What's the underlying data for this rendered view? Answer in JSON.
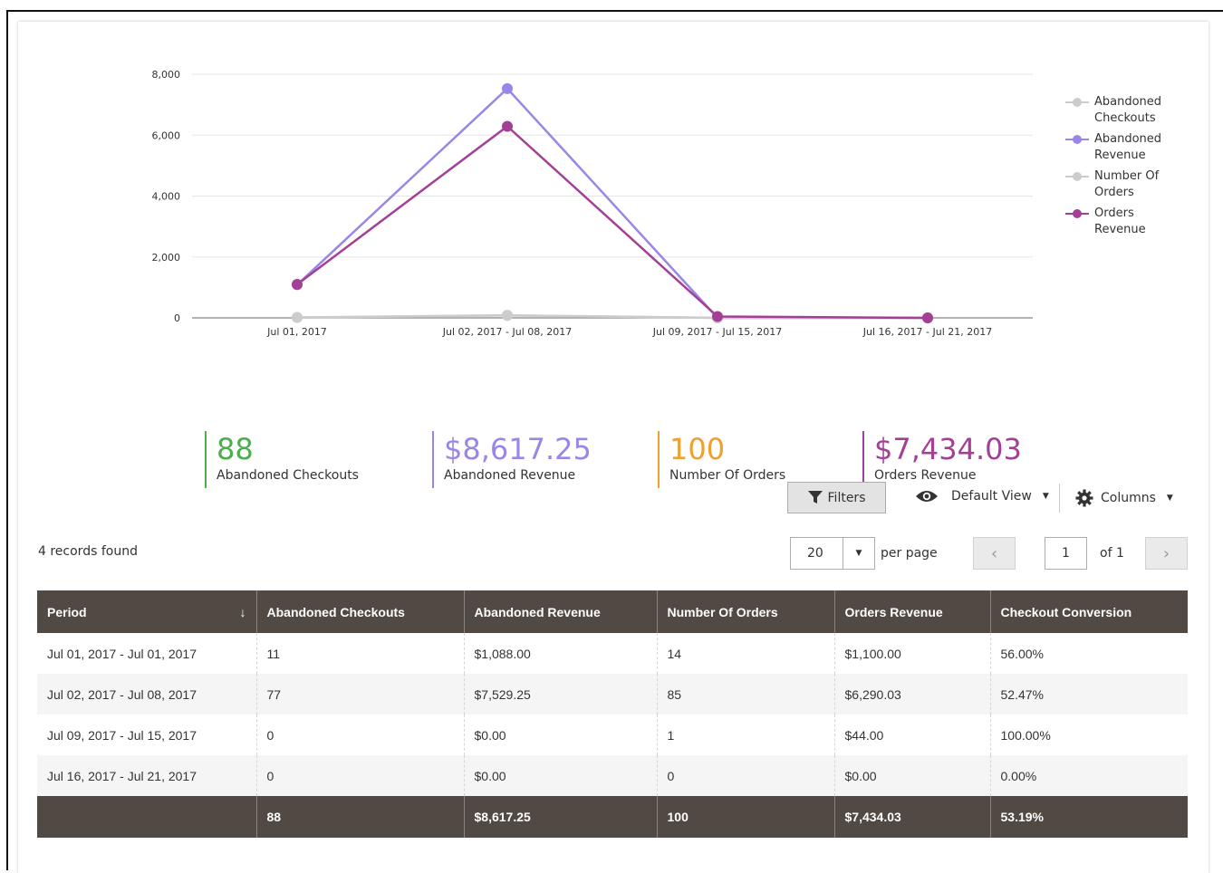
{
  "colors": {
    "abandoned_checkouts": "#cccccc",
    "abandoned_revenue": "#9a86e6",
    "number_of_orders": "#cccccc",
    "orders_revenue": "#a43f96",
    "kpi_checkouts": "#4cae4c",
    "kpi_abandoned_revenue": "#9a86e6",
    "kpi_orders": "#f0a030",
    "kpi_orders_revenue": "#a43f96",
    "table_header": "#514943"
  },
  "chart_data": {
    "type": "line",
    "categories": [
      "Jul 01, 2017",
      "Jul 02, 2017 - Jul 08, 2017",
      "Jul 09, 2017 - Jul 15, 2017",
      "Jul 16, 2017 - Jul 21, 2017"
    ],
    "y_ticks": [
      "0",
      "2,000",
      "4,000",
      "6,000",
      "8,000"
    ],
    "ylim": [
      0,
      8000
    ],
    "grid": true,
    "legend_position": "right",
    "series": [
      {
        "name": "Abandoned Checkouts",
        "values": [
          11,
          77,
          0,
          0
        ],
        "color": "#cccccc"
      },
      {
        "name": "Abandoned Revenue",
        "values": [
          1088.0,
          7529.25,
          0,
          0
        ],
        "color": "#9a86e6"
      },
      {
        "name": "Number Of Orders",
        "values": [
          14,
          85,
          1,
          0
        ],
        "color": "#cccccc"
      },
      {
        "name": "Orders Revenue",
        "values": [
          1100.0,
          6290.03,
          44.0,
          0
        ],
        "color": "#a43f96"
      }
    ]
  },
  "legend": [
    {
      "label_line1": "Abandoned",
      "label_line2": "Checkouts",
      "color": "#cccccc"
    },
    {
      "label_line1": "Abandoned",
      "label_line2": "Revenue",
      "color": "#9a86e6"
    },
    {
      "label_line1": "Number Of",
      "label_line2": "Orders",
      "color": "#cccccc"
    },
    {
      "label_line1": "Orders",
      "label_line2": "Revenue",
      "color": "#a43f96"
    }
  ],
  "kpis": [
    {
      "value": "88",
      "label": "Abandoned Checkouts"
    },
    {
      "value": "$8,617.25",
      "label": "Abandoned Revenue"
    },
    {
      "value": "100",
      "label": "Number Of Orders"
    },
    {
      "value": "$7,434.03",
      "label": "Orders Revenue"
    }
  ],
  "toolbar": {
    "filters_label": "Filters",
    "view_label": "Default View",
    "columns_label": "Columns"
  },
  "grid_controls": {
    "records_found": "4 records found",
    "per_page_value": "20",
    "per_page_label": "per page",
    "current_page": "1",
    "of_pages": "of 1"
  },
  "table": {
    "headers": [
      "Period",
      "Abandoned Checkouts",
      "Abandoned Revenue",
      "Number Of Orders",
      "Orders Revenue",
      "Checkout Conversion"
    ],
    "rows": [
      [
        "Jul 01, 2017 - Jul 01, 2017",
        "11",
        "$1,088.00",
        "14",
        "$1,100.00",
        "56.00%"
      ],
      [
        "Jul 02, 2017 - Jul 08, 2017",
        "77",
        "$7,529.25",
        "85",
        "$6,290.03",
        "52.47%"
      ],
      [
        "Jul 09, 2017 - Jul 15, 2017",
        "0",
        "$0.00",
        "1",
        "$44.00",
        "100.00%"
      ],
      [
        "Jul 16, 2017 - Jul 21, 2017",
        "0",
        "$0.00",
        "0",
        "$0.00",
        "0.00%"
      ]
    ],
    "totals": [
      "",
      "88",
      "$8,617.25",
      "100",
      "$7,434.03",
      "53.19%"
    ]
  }
}
